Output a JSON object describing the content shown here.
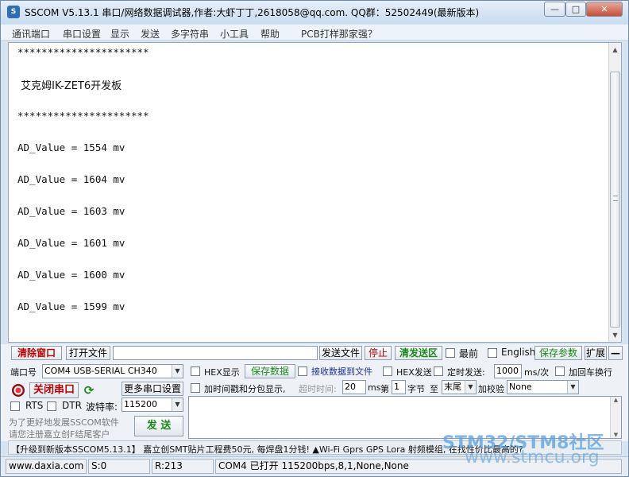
{
  "window": {
    "title": "SSCOM V5.13.1 串口/网络数据调试器,作者:大虾丁丁,2618058@qq.com. QQ群：52502449(最新版本)",
    "minimize": "—",
    "maximize": "□",
    "close": "✕"
  },
  "menu": [
    "通讯端口",
    "串口设置",
    "显示",
    "发送",
    "多字符串",
    "小工具",
    "帮助",
    "PCB打样那家强？"
  ],
  "output_lines": [
    "**********************",
    " 艾克姆IK-ZET6开发板",
    "**********************",
    "AD_Value = 1554 mv",
    "AD_Value = 1604 mv",
    "AD_Value = 1603 mv",
    "AD_Value = 1601 mv",
    "AD_Value = 1600 mv",
    "AD_Value = 1599 mv"
  ],
  "scroll": {
    "up": "▲",
    "down": "▼",
    "grip": "≡"
  },
  "toolbar": {
    "clear": "清除窗口",
    "open_file": "打开文件",
    "file_path": "",
    "send_file": "发送文件",
    "stop": "停止",
    "clear_send": "清发送区",
    "top_most": "最前",
    "english": "English",
    "save_params": "保存参数",
    "expand": "扩展",
    "collapse": "—"
  },
  "port": {
    "label": "端口号",
    "value": "COM4 USB-SERIAL CH340",
    "close_port": "关闭串口",
    "more_settings": "更多串口设置",
    "rts": "RTS",
    "dtr": "DTR",
    "baud_label": "波特率:",
    "baud": "115200",
    "promo1": "为了更好地发展SSCOM软件",
    "promo2": "请您注册嘉立创F结尾客户",
    "send": "发 送"
  },
  "options": {
    "hex_display": "HEX显示",
    "save_data": "保存数据",
    "recv_to_file": "接收数据到文件",
    "hex_send": "HEX发送",
    "timed_send": "定时发送:",
    "interval": "1000",
    "interval_unit": "ms/次",
    "add_crlf": "加回车换行",
    "timestamp": "加时间戳和分包显示,",
    "timeout_label": "超时时间:",
    "timeout": "20",
    "timeout_unit": "ms",
    "byte_prefix": "第",
    "byte_index": "1",
    "byte_suffix": "字节",
    "to": "至",
    "tail": "末尾",
    "checksum_label": "加校验",
    "checksum": "None"
  },
  "ticker": "【升级到新版本SSCOM5.13.1】  嘉立创SMT贴片工程费50元, 每焊盘1分钱! ▲Wi-Fi Gprs GPS Lora 射频模组, 在找性价比最高的?",
  "status": {
    "website": "www.daxia.com",
    "sent": "S:0",
    "received": "R:213",
    "port_state": "COM4 已打开  115200bps,8,1,None,None"
  },
  "watermark": {
    "line1": "STM32/STM8社区",
    "line2": "www.stmcu.org"
  },
  "colors": {
    "accent_red": "#c00000",
    "accent_green": "#1b8a1b",
    "watermark": "#5aa0e0"
  }
}
